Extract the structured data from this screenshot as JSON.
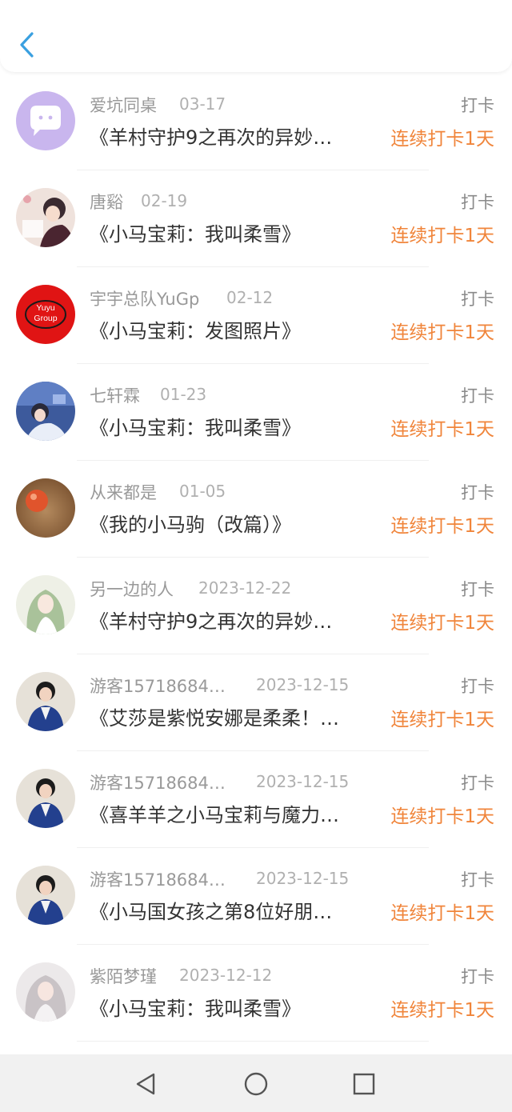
{
  "header": {
    "back_icon": "chevron-left-icon",
    "accent_color": "#3aa0e0"
  },
  "list": [
    {
      "name": "爱坑同桌",
      "date": "03-17",
      "punch": "打卡",
      "title": "《羊村守护9之再次的异妙…",
      "streak": "连续打卡1天",
      "avatar": "chat-bubble-icon"
    },
    {
      "name": "唐谿",
      "date": "02-19",
      "punch": "打卡",
      "title": "《小马宝莉：我叫柔雪》",
      "streak": "连续打卡1天",
      "avatar": "anime-portrait"
    },
    {
      "name": "宇宇总队YuGp",
      "date": "02-12",
      "punch": "打卡",
      "title": "《小马宝莉：发图照片》",
      "streak": "连续打卡1天",
      "avatar": "yuyu-group-logo",
      "avatar_text": "Yuyu Group"
    },
    {
      "name": "七轩霖",
      "date": "01-23",
      "punch": "打卡",
      "title": "《小马宝莉：我叫柔雪》",
      "streak": "连续打卡1天",
      "avatar": "anime-portrait"
    },
    {
      "name": "从来都是",
      "date": "01-05",
      "punch": "打卡",
      "title": "《我的小马驹（改篇）》",
      "streak": "连续打卡1天",
      "avatar": "orange-ball"
    },
    {
      "name": "另一边的人",
      "date": "2023-12-22",
      "punch": "打卡",
      "title": "《羊村守护9之再次的异妙…",
      "streak": "连续打卡1天",
      "avatar": "anime-portrait"
    },
    {
      "name": "游客15718684…",
      "date": "2023-12-15",
      "punch": "打卡",
      "title": "《艾莎是紫悦安娜是柔柔！…",
      "streak": "连续打卡1天",
      "avatar": "person-photo"
    },
    {
      "name": "游客15718684…",
      "date": "2023-12-15",
      "punch": "打卡",
      "title": "《喜羊羊之小马宝莉与魔力…",
      "streak": "连续打卡1天",
      "avatar": "person-photo"
    },
    {
      "name": "游客15718684…",
      "date": "2023-12-15",
      "punch": "打卡",
      "title": "《小马国女孩之第8位好朋…",
      "streak": "连续打卡1天",
      "avatar": "person-photo"
    },
    {
      "name": "紫陌梦瑾",
      "date": "2023-12-12",
      "punch": "打卡",
      "title": "《小马宝莉：我叫柔雪》",
      "streak": "连续打卡1天",
      "avatar": "anime-portrait"
    }
  ],
  "navbar": {
    "back_icon": "triangle-back-icon",
    "home_icon": "circle-home-icon",
    "recents_icon": "square-recents-icon"
  },
  "colors": {
    "streak": "#f0853b",
    "name": "#999999",
    "title": "#333333"
  }
}
